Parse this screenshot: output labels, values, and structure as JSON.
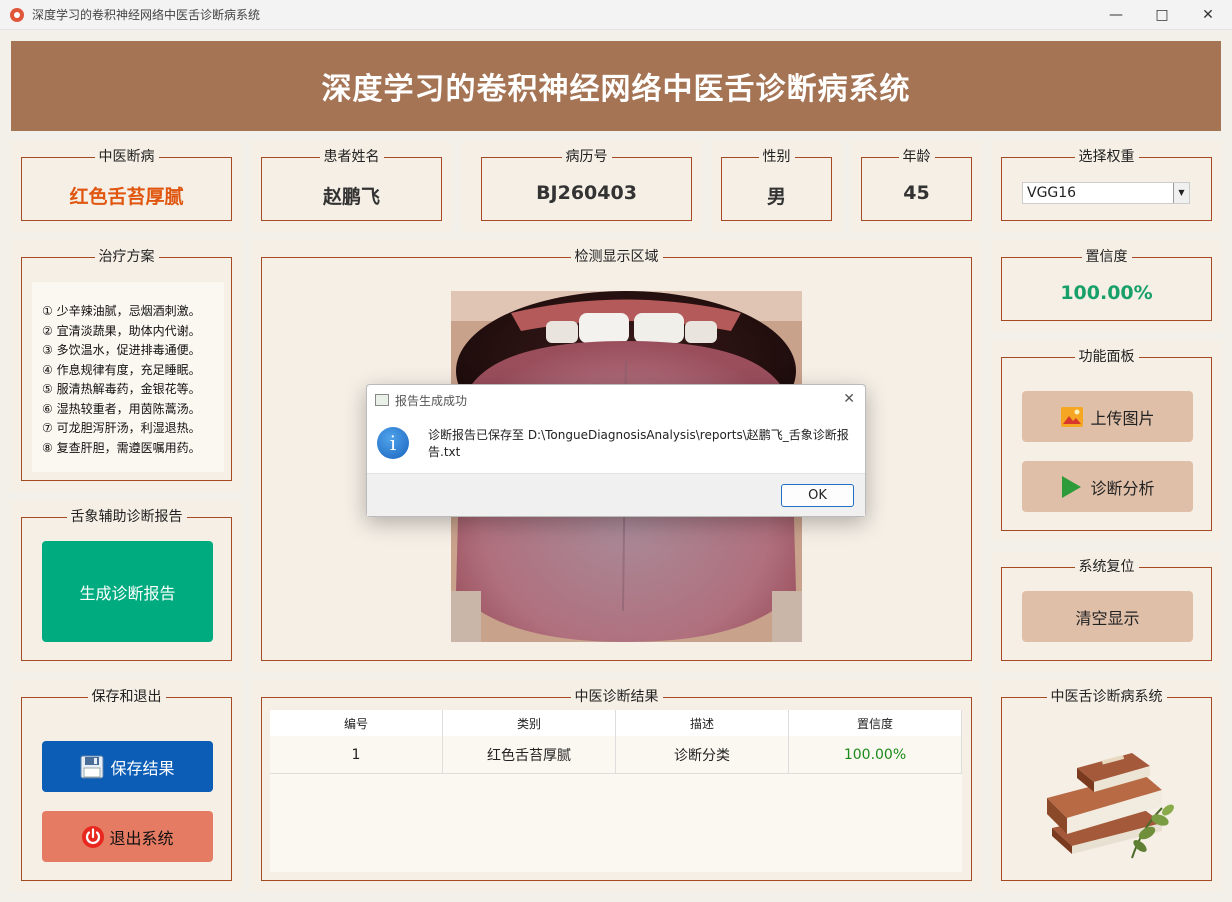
{
  "window": {
    "title": "深度学习的卷积神经网络中医舌诊断病系统"
  },
  "header": {
    "title": "深度学习的卷积神经网络中医舌诊断病系统"
  },
  "info": {
    "diagnosis": {
      "label": "中医断病",
      "value": "红色舌苔厚腻"
    },
    "patient_name": {
      "label": "患者姓名",
      "value": "赵鹏飞"
    },
    "record_no": {
      "label": "病历号",
      "value": "BJ260403"
    },
    "gender": {
      "label": "性别",
      "value": "男"
    },
    "age": {
      "label": "年龄",
      "value": "45"
    },
    "weights": {
      "label": "选择权重",
      "value": "VGG16"
    }
  },
  "treatment": {
    "label": "治疗方案",
    "items": [
      "① 少辛辣油腻，忌烟酒刺激。",
      "② 宜清淡蔬果，助体内代谢。",
      "③ 多饮温水，促进排毒通便。",
      "④ 作息规律有度，充足睡眠。",
      "⑤ 服清热解毒药，金银花等。",
      "⑥ 湿热较重者，用茵陈蒿汤。",
      "⑦ 可龙胆泻肝汤，利湿退热。",
      "⑧ 复查肝胆，需遵医嘱用药。"
    ]
  },
  "report": {
    "label": "舌象辅助诊断报告",
    "button": "生成诊断报告"
  },
  "save_exit": {
    "label": "保存和退出",
    "save": "保存结果",
    "exit": "退出系统"
  },
  "detection": {
    "label": "检测显示区域"
  },
  "confidence": {
    "label": "置信度",
    "value": "100.00%"
  },
  "functions": {
    "label": "功能面板",
    "upload": "上传图片",
    "analyze": "诊断分析"
  },
  "reset": {
    "label": "系统复位",
    "clear": "清空显示"
  },
  "brand": {
    "label": "中医舌诊断病系统"
  },
  "results": {
    "label": "中医诊断结果",
    "columns": [
      "编号",
      "类别",
      "描述",
      "置信度"
    ],
    "rows": [
      [
        "1",
        "红色舌苔厚腻",
        "诊断分类",
        "100.00%"
      ]
    ]
  },
  "dialog": {
    "title": "报告生成成功",
    "message": "诊断报告已保存至 D:\\TongueDiagnosisAnalysis\\reports\\赵鹏飞_舌象诊断报告.txt",
    "ok": "OK"
  },
  "colors": {
    "header": "#a57454",
    "accent_orange": "#e0560f",
    "confidence_green": "#18a06a",
    "report_button": "#00ac7f",
    "save_button": "#0c5db5",
    "exit_button": "#e57b62",
    "border": "#a64a25"
  }
}
